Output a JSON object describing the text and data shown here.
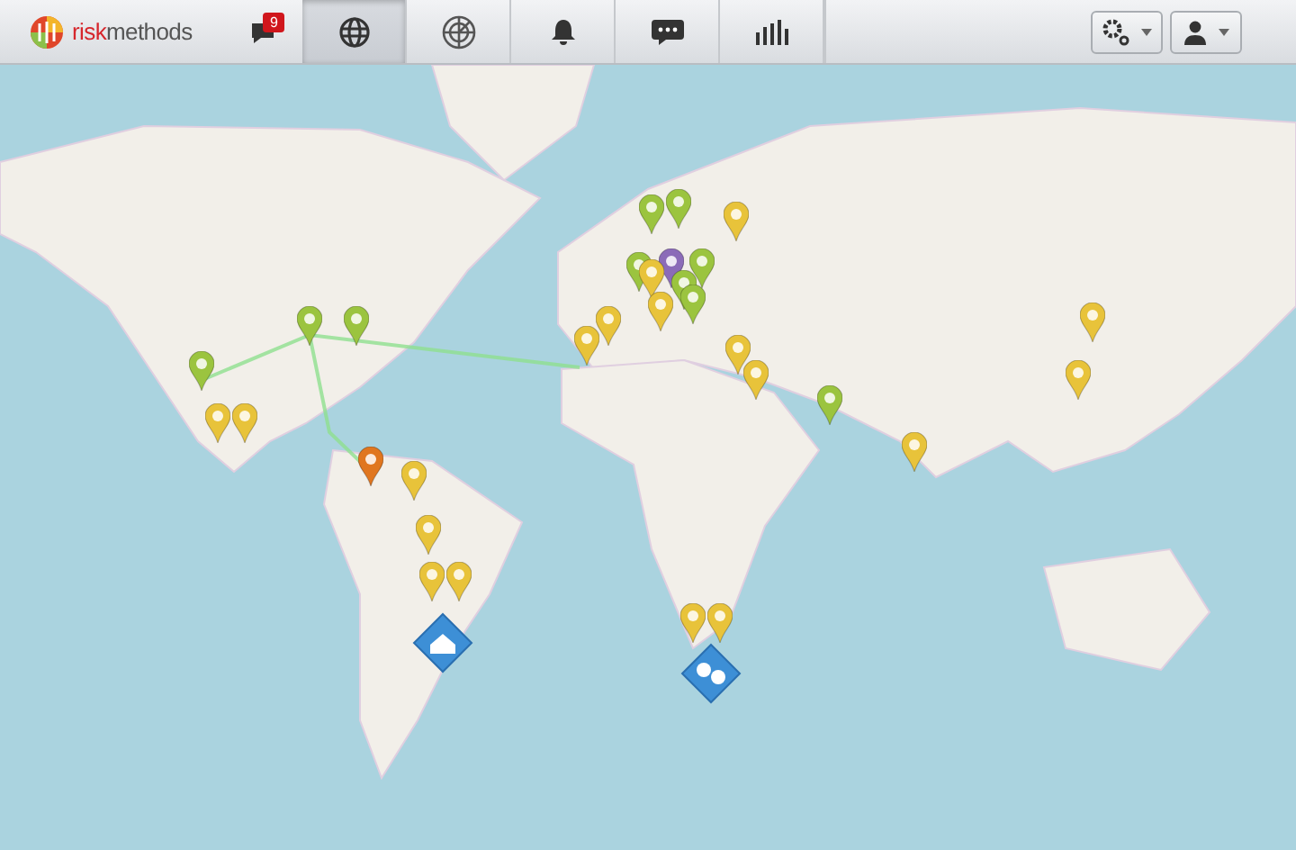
{
  "header": {
    "logo": [
      "risk",
      "methods"
    ],
    "nav": [
      {
        "kind": "messages",
        "badge": "9",
        "selected": false
      },
      {
        "kind": "globe",
        "selected": true
      },
      {
        "kind": "radar",
        "selected": false
      },
      {
        "kind": "bell",
        "selected": false
      },
      {
        "kind": "chat",
        "selected": false
      },
      {
        "kind": "chart",
        "selected": false
      }
    ],
    "menus": [
      {
        "kind": "settings"
      },
      {
        "kind": "user"
      }
    ]
  },
  "map": {
    "pins": [
      {
        "color": "#9bc43f"
      },
      {
        "color": "#9bc43f"
      },
      {
        "color": "#9bc43f"
      },
      {
        "color": "#e8c33a"
      },
      {
        "color": "#e8c33a"
      },
      {
        "color": "#e0761f"
      },
      {
        "color": "#e8c33a"
      },
      {
        "color": "#e8c33a"
      },
      {
        "color": "#e8c33a"
      },
      {
        "color": "#e8c33a"
      },
      {
        "color": "#9bc43f"
      },
      {
        "color": "#9bc43f"
      },
      {
        "color": "#e8c33a"
      },
      {
        "color": "#9bc43f"
      },
      {
        "color": "#8b6bb8"
      },
      {
        "color": "#e8c33a"
      },
      {
        "color": "#9bc43f"
      },
      {
        "color": "#9bc43f"
      },
      {
        "color": "#9bc43f"
      },
      {
        "color": "#e8c33a"
      },
      {
        "color": "#e8c33a"
      },
      {
        "color": "#e8c33a"
      },
      {
        "color": "#e8c33a"
      },
      {
        "color": "#e8c33a"
      },
      {
        "color": "#9bc43f"
      },
      {
        "color": "#e8c33a"
      },
      {
        "color": "#e8c33a"
      },
      {
        "color": "#e8c33a"
      },
      {
        "color": "#e8c33a"
      },
      {
        "color": "#e8c33a"
      }
    ],
    "clusters": [
      {
        "kind": "home"
      },
      {
        "kind": "pins"
      }
    ]
  }
}
